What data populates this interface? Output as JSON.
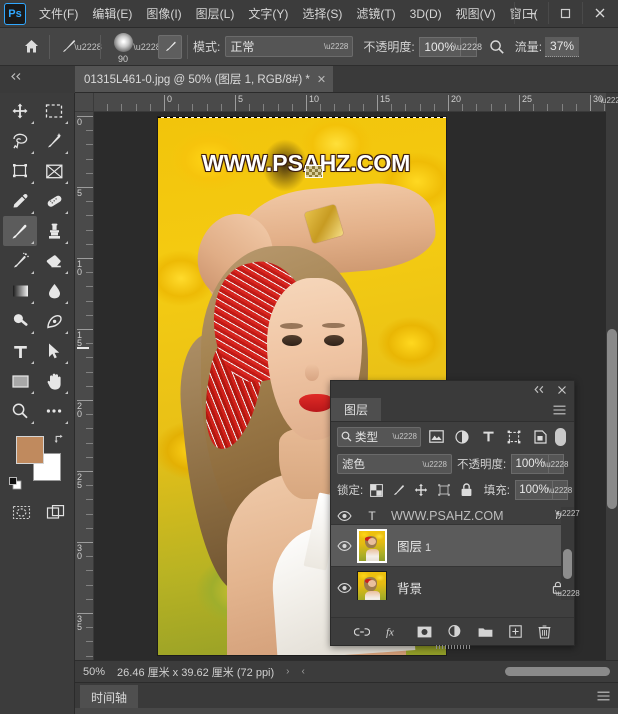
{
  "app": {
    "logo_text": "Ps",
    "menus": [
      {
        "label": "文件(F)"
      },
      {
        "label": "编辑(E)"
      },
      {
        "label": "图像(I)"
      },
      {
        "label": "图层(L)"
      },
      {
        "label": "文字(Y)"
      },
      {
        "label": "选择(S)"
      },
      {
        "label": "滤镜(T)"
      },
      {
        "label": "3D(D)"
      },
      {
        "label": "视图(V)"
      },
      {
        "label": "窗口("
      }
    ],
    "window_controls": {
      "minimize": "–",
      "maximize": "☐",
      "close": "✕"
    }
  },
  "options_bar": {
    "home_icon": "home-icon",
    "brush_tip_icon": "brush-tip-icon",
    "brush_size": "90",
    "airbrush_icon": "airbrush-icon",
    "mode_label": "模式:",
    "mode_value": "正常",
    "opacity_label": "不透明度:",
    "opacity_value": "100%",
    "search_icon": "magnifier-icon",
    "flow_label": "流量:",
    "flow_value": "37%"
  },
  "document_tab": {
    "title": "01315L461-0.jpg @ 50% (图层 1, RGB/8#) *",
    "close": "✕"
  },
  "toolbar": {
    "tools": [
      {
        "name": "move-tool",
        "active": false
      },
      {
        "name": "marquee-tool",
        "active": false
      },
      {
        "name": "lasso-tool",
        "active": false
      },
      {
        "name": "quick-select-tool",
        "active": false
      },
      {
        "name": "crop-tool",
        "active": false
      },
      {
        "name": "frame-tool",
        "active": false
      },
      {
        "name": "eyedropper-tool",
        "active": false
      },
      {
        "name": "healing-brush-tool",
        "active": false
      },
      {
        "name": "brush-tool",
        "active": true
      },
      {
        "name": "clone-stamp-tool",
        "active": false
      },
      {
        "name": "history-brush-tool",
        "active": false
      },
      {
        "name": "eraser-tool",
        "active": false
      },
      {
        "name": "gradient-tool",
        "active": false
      },
      {
        "name": "blur-tool",
        "active": false
      },
      {
        "name": "dodge-tool",
        "active": false
      },
      {
        "name": "pen-tool",
        "active": false
      },
      {
        "name": "type-tool",
        "active": false
      },
      {
        "name": "path-select-tool",
        "active": false
      },
      {
        "name": "rectangle-tool",
        "active": false
      },
      {
        "name": "hand-tool",
        "active": false
      },
      {
        "name": "zoom-tool",
        "active": false
      },
      {
        "name": "more-tools",
        "active": false
      }
    ],
    "foreground_color": "#c08a5e",
    "background_color": "#ffffff",
    "quick_mask_icon": "quick-mask-icon",
    "screen_mode_icon": "screen-mode-icon"
  },
  "rulers": {
    "horizontal_ticks": [
      "0",
      "5",
      "10",
      "15",
      "20",
      "25",
      "30"
    ],
    "vertical_ticks": [
      "0",
      "5",
      "10",
      "15",
      "20",
      "25",
      "30",
      "35"
    ],
    "unit": "厘米"
  },
  "canvas": {
    "watermark_text": "WWW.PSAHZ.COM"
  },
  "status_bar": {
    "zoom": "50%",
    "dimensions": "26.46 厘米 x 39.62 厘米 (72 ppi)",
    "arrow_right": "›",
    "arrow_left": "‹"
  },
  "timeline": {
    "tab_label": "时间轴",
    "menu_icon": "panel-menu-icon"
  },
  "layers_panel": {
    "collapse_icon": "«",
    "close_icon": "✕",
    "tab_label": "图层",
    "menu_icon": "panel-menu-icon",
    "filter": {
      "search_icon": "search-icon",
      "type_label": "类型",
      "caret": "∨",
      "icons": [
        "pixel-filter-icon",
        "adjustment-filter-icon",
        "type-filter-icon",
        "shape-filter-icon",
        "smartobject-filter-icon"
      ],
      "toggle": "filter-toggle"
    },
    "blend_mode": "滤色",
    "blend_caret": "∨",
    "opacity_label": "不透明度:",
    "opacity_value": "100%",
    "lock_label": "锁定:",
    "lock_icons": [
      "lock-transparency-icon",
      "lock-pixels-icon",
      "lock-position-icon",
      "lock-artboard-icon",
      "lock-all-icon"
    ],
    "fill_label": "填充:",
    "fill_value": "100%",
    "layers": [
      {
        "name": "WWW.PSAHZ.COM",
        "type": "text",
        "visible": true,
        "selected": false,
        "partial": true,
        "effects": "fx"
      },
      {
        "name": "图层",
        "index": "1",
        "type": "pixel",
        "visible": true,
        "selected": true,
        "partial": false
      },
      {
        "name": "背景",
        "type": "background",
        "visible": true,
        "selected": false,
        "partial": false,
        "locked": true
      }
    ],
    "footer_buttons": [
      {
        "name": "link-layers-button",
        "glyph": "link"
      },
      {
        "name": "layer-style-button",
        "glyph": "fx"
      },
      {
        "name": "add-mask-button",
        "glyph": "mask"
      },
      {
        "name": "new-adjustment-button",
        "glyph": "adjust"
      },
      {
        "name": "new-group-button",
        "glyph": "folder"
      },
      {
        "name": "new-layer-button",
        "glyph": "plus"
      },
      {
        "name": "delete-layer-button",
        "glyph": "trash"
      }
    ]
  }
}
